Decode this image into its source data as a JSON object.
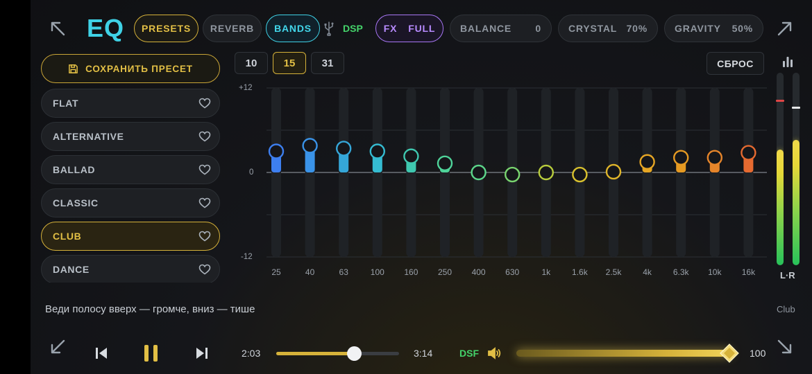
{
  "header": {
    "title": "EQ",
    "presets_tab": "PRESETS",
    "reverb_tab": "REVERB",
    "bands_tab": "BANDS",
    "dsp_label": "DSP",
    "fx_label": "FX",
    "full_label": "FULL",
    "balance": {
      "label": "BALANCE",
      "value": "0"
    },
    "crystal": {
      "label": "CRYSTAL",
      "value": "70%"
    },
    "gravity": {
      "label": "GRAVITY",
      "value": "50%"
    }
  },
  "sidebar": {
    "save_preset": "СОХРАНИТЬ ПРЕСЕТ",
    "presets": [
      {
        "label": "FLAT",
        "active": false
      },
      {
        "label": "ALTERNATIVE",
        "active": false
      },
      {
        "label": "BALLAD",
        "active": false
      },
      {
        "label": "CLASSIC",
        "active": false
      },
      {
        "label": "CLUB",
        "active": true
      },
      {
        "label": "DANCE",
        "active": false
      }
    ]
  },
  "band_count": {
    "options": [
      "10",
      "15",
      "31"
    ],
    "selected": "15"
  },
  "reset_label": "СБРОС",
  "graph": {
    "db_max": "+12",
    "db_zero": "0",
    "db_min": "-12"
  },
  "chart_data": {
    "type": "bar",
    "ylim": [
      -12,
      12
    ],
    "categories": [
      "25",
      "40",
      "63",
      "100",
      "160",
      "250",
      "400",
      "630",
      "1k",
      "1.6k",
      "2.5k",
      "4k",
      "6.3k",
      "10k",
      "16k"
    ],
    "values": [
      3.0,
      3.8,
      3.4,
      3.0,
      2.3,
      1.3,
      0.0,
      -0.3,
      0.0,
      -0.3,
      0.1,
      1.5,
      2.1,
      2.1,
      2.8
    ],
    "colors": [
      "#3d7ff0",
      "#3a93e8",
      "#35a7d9",
      "#35bcd2",
      "#3fc8b0",
      "#4fd49a",
      "#5cd68a",
      "#79d46f",
      "#b8cc3c",
      "#d9c12e",
      "#e0b52a",
      "#e6a624",
      "#e69a22",
      "#e6852a",
      "#e66a30"
    ]
  },
  "meters": {
    "label": "L·R",
    "left_level": 0.6,
    "right_level": 0.65
  },
  "hint": "Веди полосу вверх — громче, вниз — тише",
  "current_preset": "Club",
  "player": {
    "elapsed": "2:03",
    "duration": "3:14",
    "progress": 0.63,
    "format": "DSF",
    "volume": "100",
    "volume_level": 1.0
  },
  "colors": {
    "accent": "#d6b23a",
    "cyan": "#3fd2e6",
    "green": "#44d36a",
    "purple": "#a877f5"
  }
}
